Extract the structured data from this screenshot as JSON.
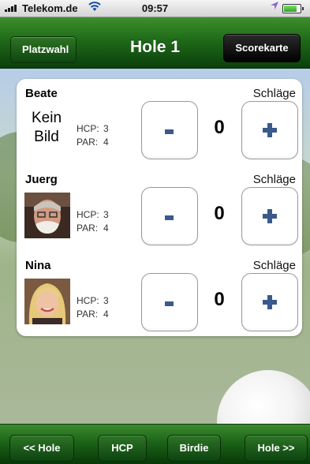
{
  "status_bar": {
    "carrier": "Telekom.de",
    "time": "09:57",
    "icons": [
      "signal-icon",
      "wifi-icon",
      "location-icon",
      "battery-icon"
    ]
  },
  "nav": {
    "back_label": "Platzwahl",
    "title": "Hole 1",
    "right_label": "Scorekarte"
  },
  "players": [
    {
      "name": "Beate",
      "strokes_label": "Schläge",
      "no_image_text": "Kein\nBild",
      "hcp_label": "HCP:",
      "hcp": "3",
      "par_label": "PAR:",
      "par": "4",
      "score": "0",
      "minus": "-",
      "plus": "+"
    },
    {
      "name": "Juerg",
      "strokes_label": "Schläge",
      "hcp_label": "HCP:",
      "hcp": "3",
      "par_label": "PAR:",
      "par": "4",
      "score": "0",
      "minus": "-",
      "plus": "+"
    },
    {
      "name": "Nina",
      "strokes_label": "Schläge",
      "hcp_label": "HCP:",
      "hcp": "3",
      "par_label": "PAR:",
      "par": "4",
      "score": "0",
      "minus": "-",
      "plus": "+"
    }
  ],
  "toolbar": {
    "prev_hole": "<< Hole",
    "hcp": "HCP",
    "birdie": "Birdie",
    "next_hole": "Hole >>"
  },
  "colors": {
    "bar_green": "#1f6a19",
    "button_symbol": "#3a5a8c"
  }
}
